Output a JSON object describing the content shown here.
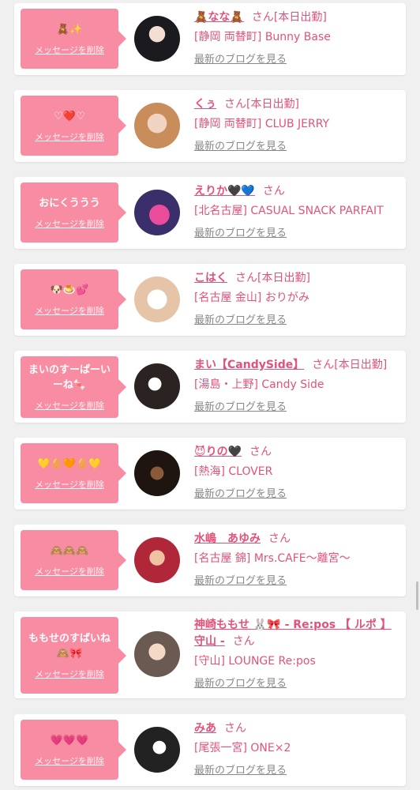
{
  "colors": {
    "accent": "#e2527a",
    "message_box": "#f78ca3",
    "background": "#f0f0f0",
    "link_gray": "#888888"
  },
  "ui": {
    "delete_label": "メッセージを削除",
    "blog_label": "最新のブログを見る",
    "san_label": "さん"
  },
  "entries": [
    {
      "message": "🧸✨",
      "name": "🧸なな🧸",
      "status": "[本日出勤]",
      "shop": "[静岡 両替町] Bunny Base",
      "avatar_icon": "avatar-bunny"
    },
    {
      "message": "♡❤️♡",
      "name": "くぅ",
      "status": "[本日出勤]",
      "shop": "[静岡 両替町] CLUB JERRY",
      "avatar_icon": "avatar-blonde"
    },
    {
      "message": "おにくううう",
      "name": "えりか🖤💙",
      "status": "",
      "shop": "[北名古屋] CASUAL SNACK PARFAIT",
      "avatar_icon": "avatar-heart"
    },
    {
      "message": "🐶🍮💕",
      "name": "こはく",
      "status": "[本日出勤]",
      "shop": "[名古屋 金山] おりがみ",
      "avatar_icon": "avatar-light"
    },
    {
      "message": "まいのすーぱーいーね🍬",
      "name": "まい【CandySide】",
      "status": "[本日出勤]",
      "shop": "[湯島・上野] Candy Side",
      "avatar_icon": "avatar-dark"
    },
    {
      "message": "💛🥚🧡🥚💛",
      "name": "😈りの🖤",
      "status": "",
      "shop": "[熱海] CLOVER",
      "avatar_icon": "avatar-night"
    },
    {
      "message": "🙈🙈🙈",
      "name": "水嶋　あゆみ",
      "status": "",
      "shop": "[名古屋 錦] Mrs.CAFE〜離宮〜",
      "avatar_icon": "avatar-red"
    },
    {
      "message": "ももせのすばいね🙈🎀",
      "name": "神崎ももせ 🐰🎀 - Re:pos 【 ルポ 】 守山 -",
      "status": "",
      "shop": "[守山] LOUNGE Re:pos",
      "avatar_icon": "avatar-sparkle"
    },
    {
      "message": "💗💗💗",
      "name": "みあ",
      "status": "",
      "shop": "[尾張一宮] ONE×2",
      "avatar_icon": "avatar-mono"
    }
  ]
}
